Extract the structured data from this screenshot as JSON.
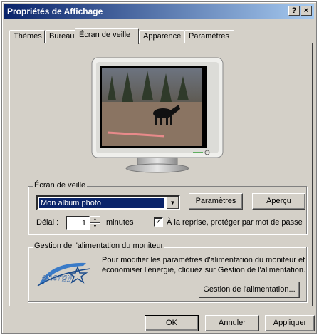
{
  "window": {
    "title": "Propriétés de Affichage",
    "help_label": "?",
    "close_label": "×"
  },
  "tabs": [
    {
      "label": "Thèmes"
    },
    {
      "label": "Bureau"
    },
    {
      "label": "Écran de veille"
    },
    {
      "label": "Apparence"
    },
    {
      "label": "Paramètres"
    }
  ],
  "active_tab": "Écran de veille",
  "screensaver": {
    "group_label": "Écran de veille",
    "selected": "Mon album photo",
    "settings_button": "Paramètres",
    "preview_button": "Aperçu",
    "delay_label": "Délai :",
    "delay_value": "1",
    "minutes_label": "minutes",
    "password_label": "À la reprise, protéger par mot de passe",
    "password_checked": true
  },
  "power": {
    "group_label": "Gestion de l'alimentation du moniteur",
    "description_line1": "Pour modifier les paramètres d'alimentation du moniteur et",
    "description_line2": "économiser l'énergie, cliquez sur Gestion de l'alimentation.",
    "button": "Gestion de l'alimentation...",
    "logo_text": "energy"
  },
  "footer": {
    "ok": "OK",
    "cancel": "Annuler",
    "apply": "Appliquer"
  },
  "colors": {
    "titlebar_start": "#0a246a",
    "titlebar_end": "#a6caf0",
    "face": "#d4d0c8",
    "highlight": "#0a246a"
  }
}
